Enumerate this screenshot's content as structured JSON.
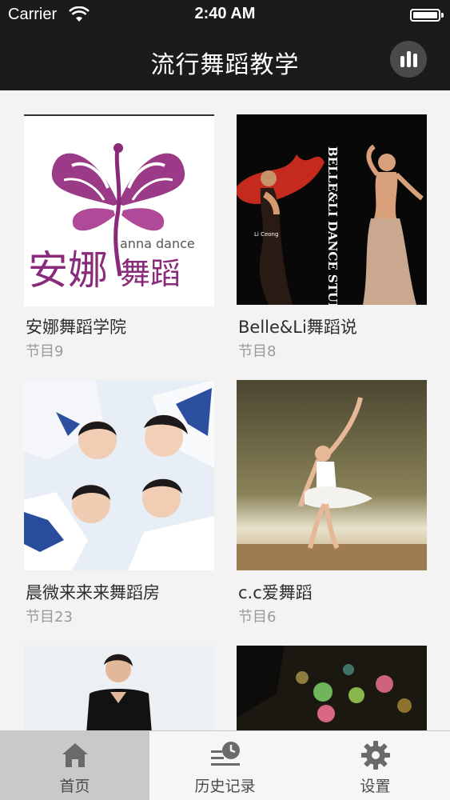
{
  "status_bar": {
    "carrier": "Carrier",
    "time": "2:40 AM"
  },
  "nav": {
    "title": "流行舞蹈教学",
    "menu_icon": "bars-icon"
  },
  "items": [
    {
      "title": "安娜舞蹈学院",
      "subtitle": "节目9",
      "logo_text_cn": "安娜",
      "logo_text_cn2": "舞蹈",
      "logo_text_en": "anna dance"
    },
    {
      "title": "Belle&Li舞蹈说",
      "subtitle": "节目8",
      "poster_text": "BELLE&LI DANCE STUDIO",
      "poster_small": "Li Ceong"
    },
    {
      "title": "晨微来来来舞蹈房",
      "subtitle": "节目23"
    },
    {
      "title": "c.c爱舞蹈",
      "subtitle": "节目6"
    },
    {
      "title": "",
      "subtitle": ""
    },
    {
      "title": "",
      "subtitle": ""
    }
  ],
  "tabbar": {
    "tabs": [
      {
        "label": "首页",
        "icon": "home-icon",
        "active": true
      },
      {
        "label": "历史记录",
        "icon": "history-icon",
        "active": false
      },
      {
        "label": "设置",
        "icon": "gear-icon",
        "active": false
      }
    ]
  },
  "colors": {
    "topbar": "#1b1b1b",
    "logo_purple": "#8a2a7a",
    "tab_active": "#c9c9c9"
  }
}
